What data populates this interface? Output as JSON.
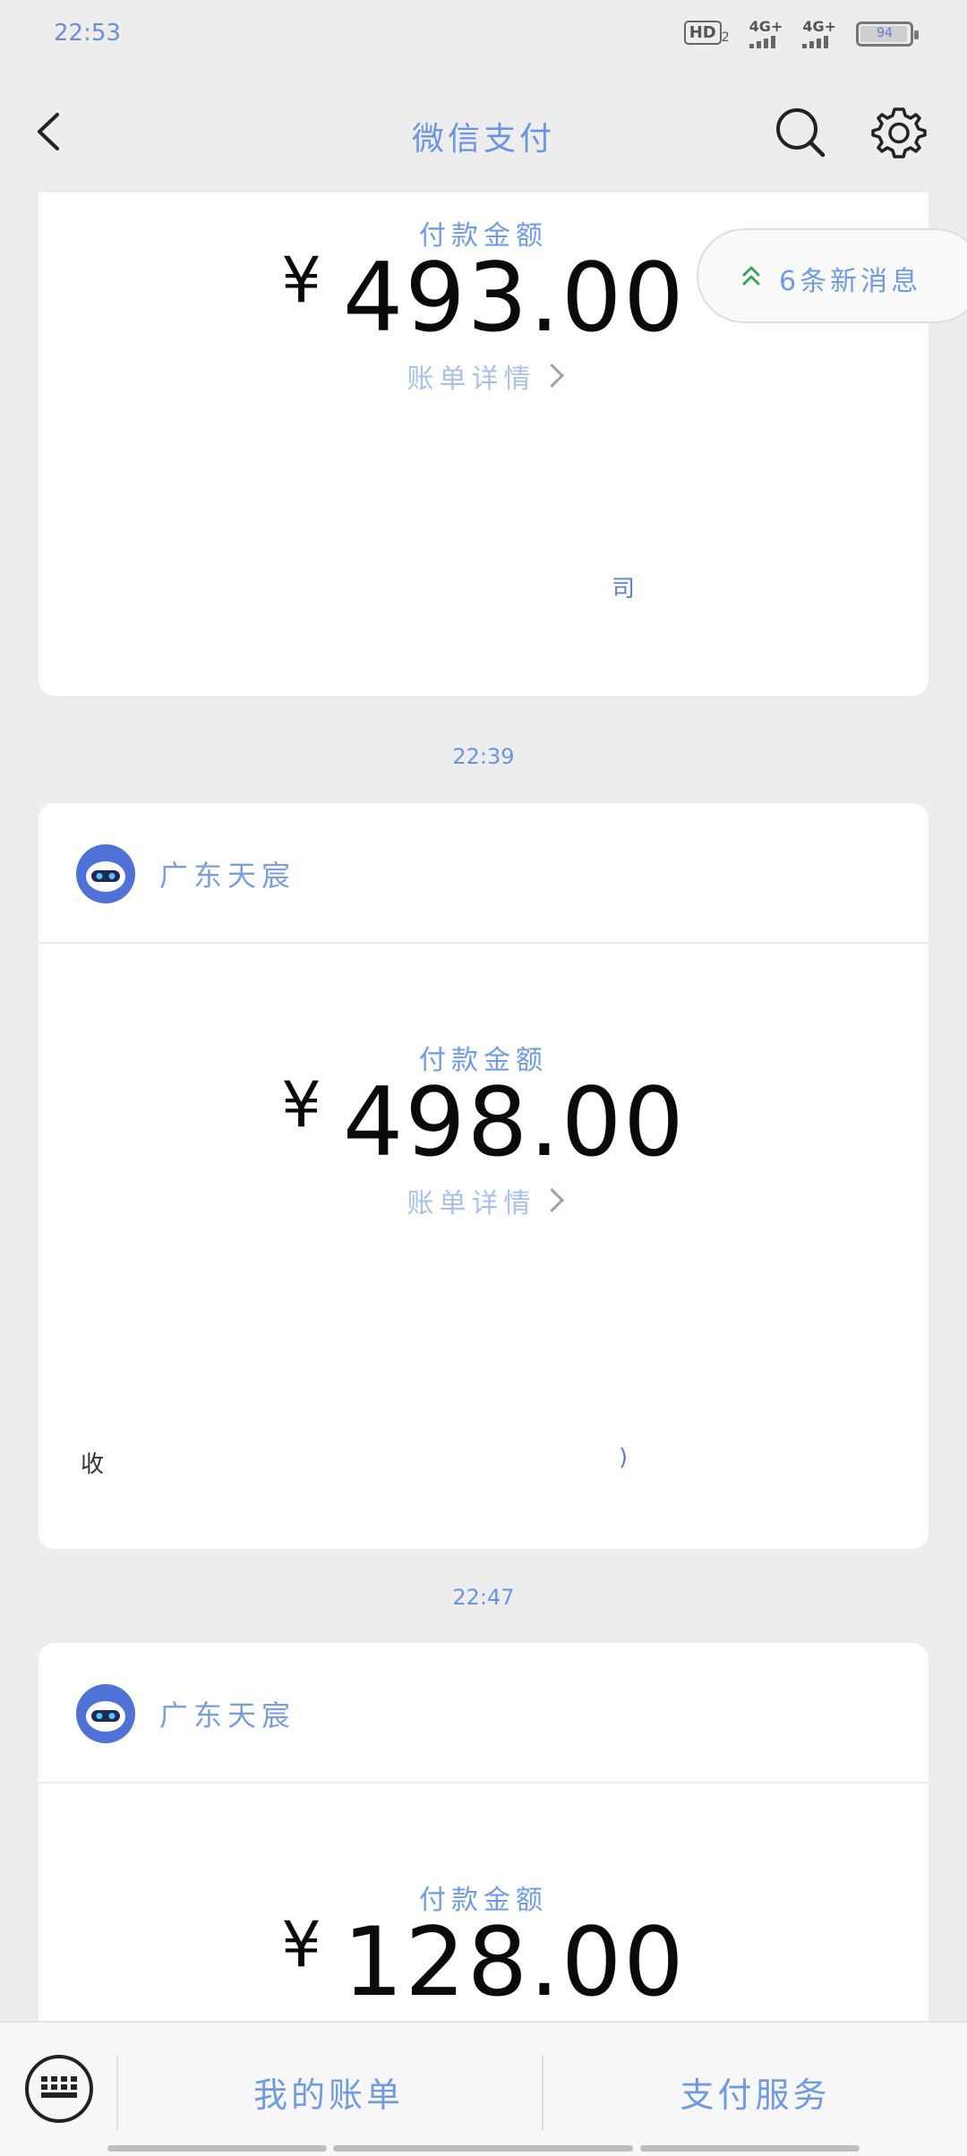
{
  "status_bar": {
    "time": "22:53",
    "hd": "HD",
    "hd_sub": "2",
    "signal1": "4G+",
    "signal2": "4G+",
    "battery": "94"
  },
  "nav": {
    "title": "微信支付"
  },
  "new_messages": {
    "text": "6条新消息"
  },
  "cards": [
    {
      "amount_label": "付款金额",
      "amount": "493.00",
      "currency": "¥",
      "bill_detail": "账单详情",
      "footer_fragment": "司"
    },
    {
      "merchant": "广东天宸",
      "amount_label": "付款金额",
      "amount": "498.00",
      "currency": "¥",
      "bill_detail": "账单详情",
      "footer_fragment_left": "收",
      "footer_fragment_right": ")"
    },
    {
      "merchant": "广东天宸",
      "amount_label": "付款金额",
      "amount": "128.00",
      "currency": "¥"
    }
  ],
  "timestamps": [
    "22:39",
    "22:47"
  ],
  "bottom_bar": {
    "tab1": "我的账单",
    "tab2": "支付服务"
  },
  "colors": {
    "accent": "#6f9be2",
    "background": "#ededed",
    "card": "#ffffff",
    "avatar_blue": "#4f72d8"
  }
}
